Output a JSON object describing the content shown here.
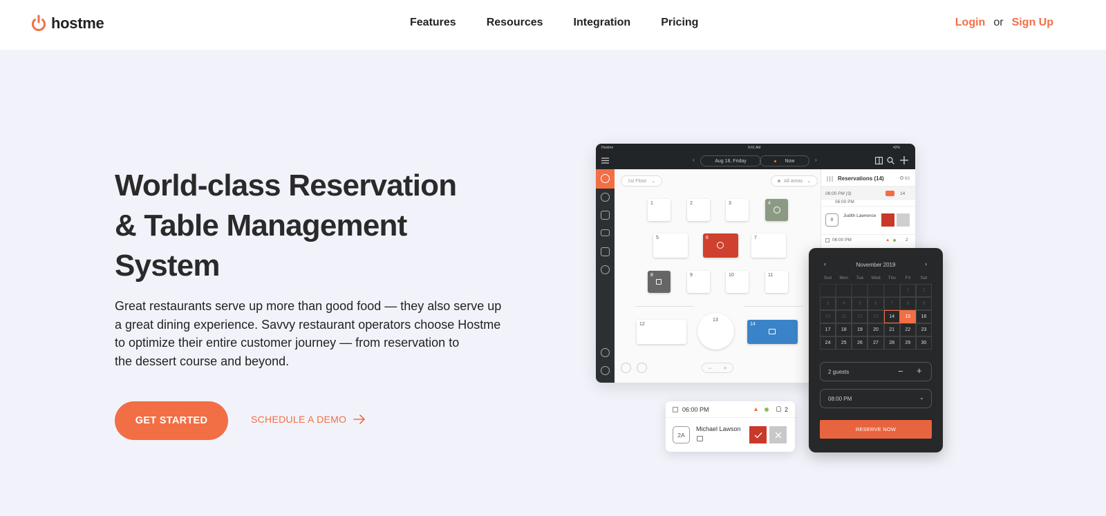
{
  "header": {
    "brand": "hostme",
    "nav": [
      "Features",
      "Resources",
      "Integration",
      "Pricing"
    ],
    "login": "Login",
    "or": "or",
    "signup": "Sign Up"
  },
  "hero": {
    "title_lines": [
      "World-class Reservation",
      "& Table Management",
      "System"
    ],
    "text_lines": [
      "Great restaurants serve up more than good food — they also serve up",
      "a great dining experience. Savvy restaurant operators choose Hostme",
      "to optimize their entire customer journey — from reservation to",
      "the dessert course and beyond."
    ],
    "cta_primary": "GET STARTED",
    "cta_secondary": "SCHEDULE A DEMO"
  },
  "colors": {
    "accent": "#f26e45",
    "dark": "#262829"
  },
  "tablet": {
    "status_left": "Hostme",
    "status_time": "9:41 AM",
    "status_battery": "42%",
    "date_pill": "Aug 18, Friday",
    "now_pill": "Now",
    "floor_chip": "1st Floor",
    "areas_chip": "All areas",
    "tables": [
      "1",
      "2",
      "3",
      "4",
      "5",
      "6",
      "7",
      "8",
      "9",
      "10",
      "11",
      "12",
      "13",
      "14"
    ],
    "reservations_title": "Reservations (14)",
    "reservations_count": "63",
    "slot_1": "06:00 PM (3)",
    "slot_1_count": "14",
    "slot_1_sub": "06:00 PM",
    "guest_badge": "8",
    "guest_name": "Judith Lawrence",
    "slot_2": "06:00 PM",
    "slot_2_count": "2"
  },
  "calendar": {
    "month": "November 2019",
    "weekdays": [
      "Sun",
      "Mon",
      "Tue",
      "Wed",
      "Thu",
      "Fri",
      "Sat"
    ],
    "guests": "2 guests",
    "time": "08:00 PM",
    "reserve": "RESERVE NOW",
    "today": "14",
    "selected": "15"
  },
  "card": {
    "time": "06:00 PM",
    "count": "2",
    "table": "2A",
    "name": "Michael Lawson"
  }
}
